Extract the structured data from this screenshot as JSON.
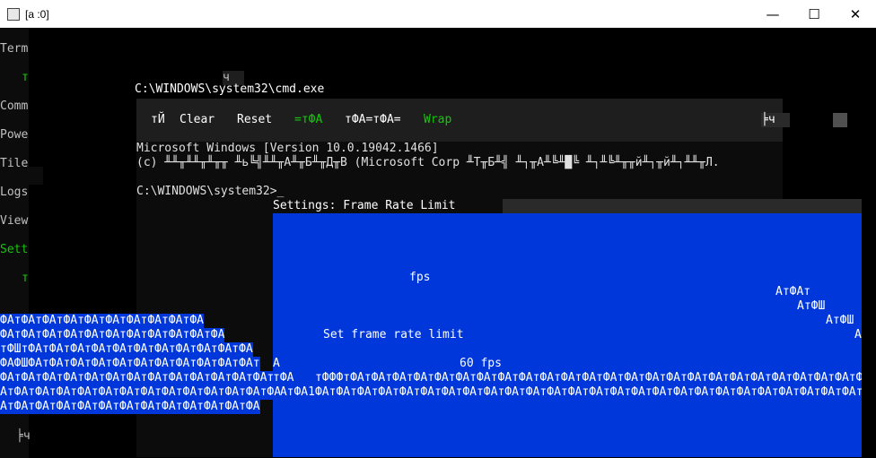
{
  "window": {
    "title": "[a        :0]",
    "minimize": "—",
    "maximize": "☐",
    "close": "✕"
  },
  "sidebar": {
    "items": [
      "Term",
      "т",
      "Comm",
      "Powe",
      "Tile",
      "Logs",
      "View",
      "Sett",
      "т"
    ],
    "bottom": "╞ч"
  },
  "top_marker": "ч",
  "inner": {
    "title": "C:\\WINDOWS\\system32\\cmd.exe",
    "toolbar": {
      "glyph": "тЙ",
      "clear": "Clear",
      "reset": "Reset",
      "opt1": "=тФА",
      "opt2": "тФА=тФА=",
      "wrap": "Wrap",
      "right": "╞ч"
    },
    "lines": [
      "Microsoft Windows [Version 10.0.19042.1466]",
      "(c) ╨╨╥╨╨╥╨╥╥ ╨ь╚╣╨╨╥А╨╥Б╨╥Д╥В (Microsoft Corp ╨Т╥Б╨╣ ╨┐╥А╨╚╨█╚ ╨┐╨╚╨╥╥й╨┐╥й╨┐╨╨╥Л.",
      "",
      "C:\\WINDOWS\\system32>_"
    ]
  },
  "settings": {
    "title": "Settings: Frame Rate Limit",
    "fps_unit": "fps",
    "right1": "АтФАт",
    "right2": "АтФШ",
    "right3": "АтФШ",
    "right4": "А",
    "label": "Set frame rate limit",
    "value_prefix": "А",
    "value": "60 fps",
    "row1": "тФА   тФФФтФАтФАтФАтФАтФАтФАтФАтФАтФАтФАтФАтФАтФАтФАтФАтФАтФАтФАтФАтФАтФАтФАтФАтФАтФАтФАтФАтФАтФАтФАтФАтФАтФАтФАтФАтФАтФАтФАтФАтФАтФАтФАтФАтФАтФАтФА╜тФАтФА",
    "row2": "ФАтФА1ФАтФАтФАтФАтФАтФАтФАтФАтФАтФАтФАтФАтФАтФАтФАтФАтФАтФАтФАтФАтФАтФАтФАтФАтФАтФАтФАтФАтФАтФАтФАтФАтФАтФАтФАтФАтФАтФАтФАтФАтФАтФАтФАтФАтФАтФА"
  },
  "left_block": [
    "ФАтФАтФАтФАтФАтФАтФАтФАтФАтФА",
    "ФАтФАтФАтФАтФАтФАтФАтФАтФАтФАтФА",
    "тФШтФАтФАтФАтФАтФАтФАтФАтФАтФАтФАтФА",
    "ФАФШФАтФАтФАтФАтФАтФАтФАтФАтФАтФАтФАт",
    "ФАтФАтФАтФАтФАтФАтФАтФАтФАтФАтФАтФАтФАт",
    "АтФАтФАтФАтФАтФАтФАтФАтФАтФАтФАтФАтФАтФА",
    "АтФАтФАтФАтФАтФАтФАтФАтФАтФАтФАтФАтФА"
  ],
  "colors": {
    "accent_green": "#16c60c",
    "panel_blue": "#0037da",
    "background": "#000000"
  }
}
